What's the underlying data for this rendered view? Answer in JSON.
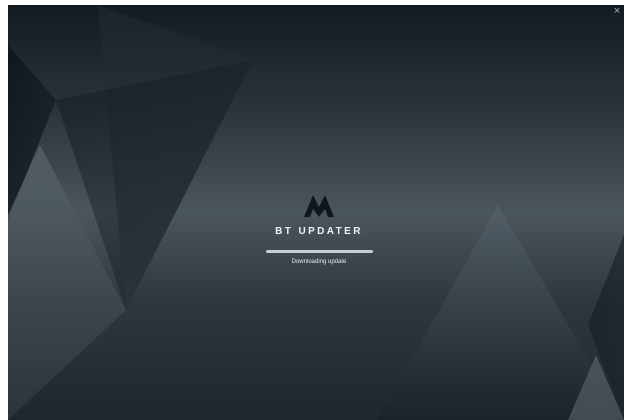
{
  "window": {
    "close_glyph": "×"
  },
  "app": {
    "title": "BT UPDATER",
    "logo_icon": "mountain-m-icon"
  },
  "progress": {
    "fraction": 1.0,
    "status": "Downloading update"
  },
  "colors": {
    "background_top": "#121b21",
    "background_mid": "#4b555c",
    "background_bottom": "#1f272c",
    "logo": "#0f171c",
    "text": "#eef2f4",
    "progress_fill": "#c7ced2"
  }
}
